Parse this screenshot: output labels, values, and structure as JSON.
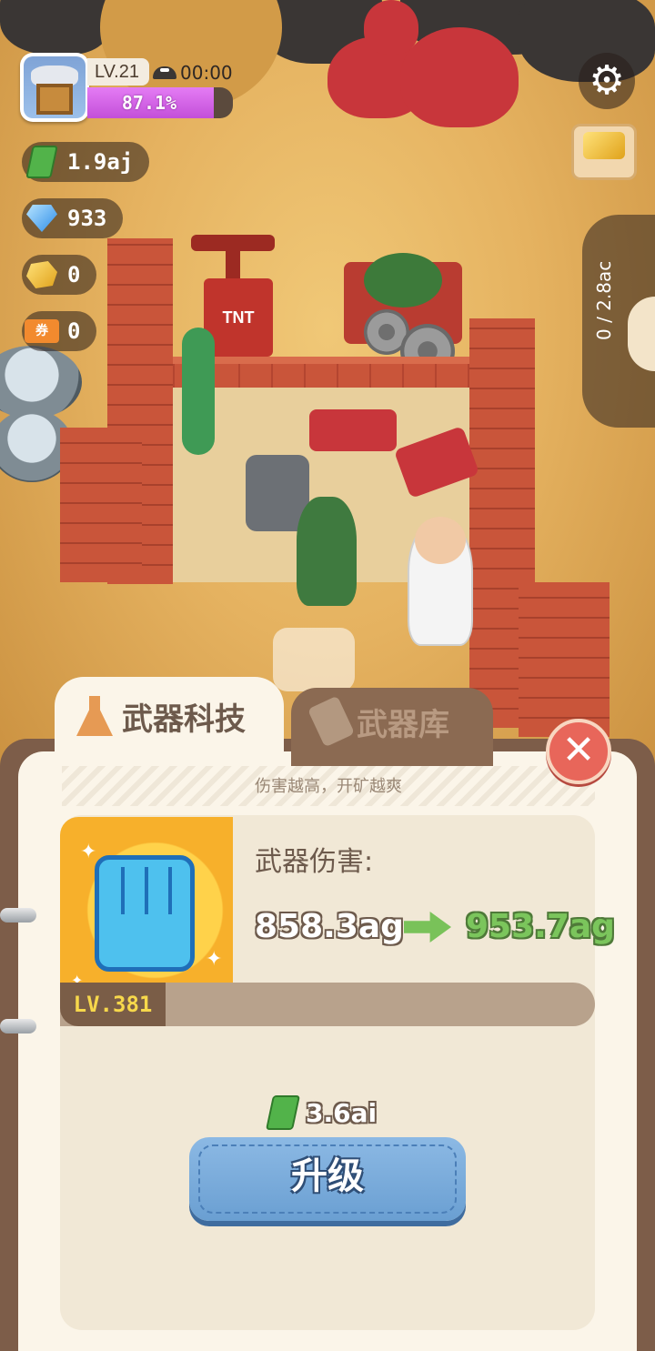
{
  "hud": {
    "level": "LV.21",
    "timer": "00:00",
    "progress_text": "87.1%",
    "progress_fraction": 0.871,
    "cash": "1.9aj",
    "diamonds": "933",
    "gold": "0",
    "tickets": "0",
    "ticket_glyph": "券",
    "capacity": "0 / 2.8ac"
  },
  "scene": {
    "tnt_label": "TNT"
  },
  "tabs": [
    {
      "label": "武器科技",
      "active": true,
      "icon": "flask-icon"
    },
    {
      "label": "武器库",
      "active": false,
      "icon": "dynamite-icon"
    }
  ],
  "panel": {
    "subtitle": "伤害越高，开矿越爽",
    "close_glyph": "✕",
    "weapon": {
      "level": "LV.381",
      "stat_label": "武器伤害:",
      "current": "858.3ag",
      "next": "953.7ag"
    },
    "cost": "3.6ai",
    "upgrade_label": "升级"
  },
  "colors": {
    "accent_purple": "#c34fd9",
    "tab_bg": "#fbf5e9",
    "upgrade_blue": "#6a9fd2",
    "close_red": "#e8665a",
    "next_green": "#7bc55c"
  }
}
